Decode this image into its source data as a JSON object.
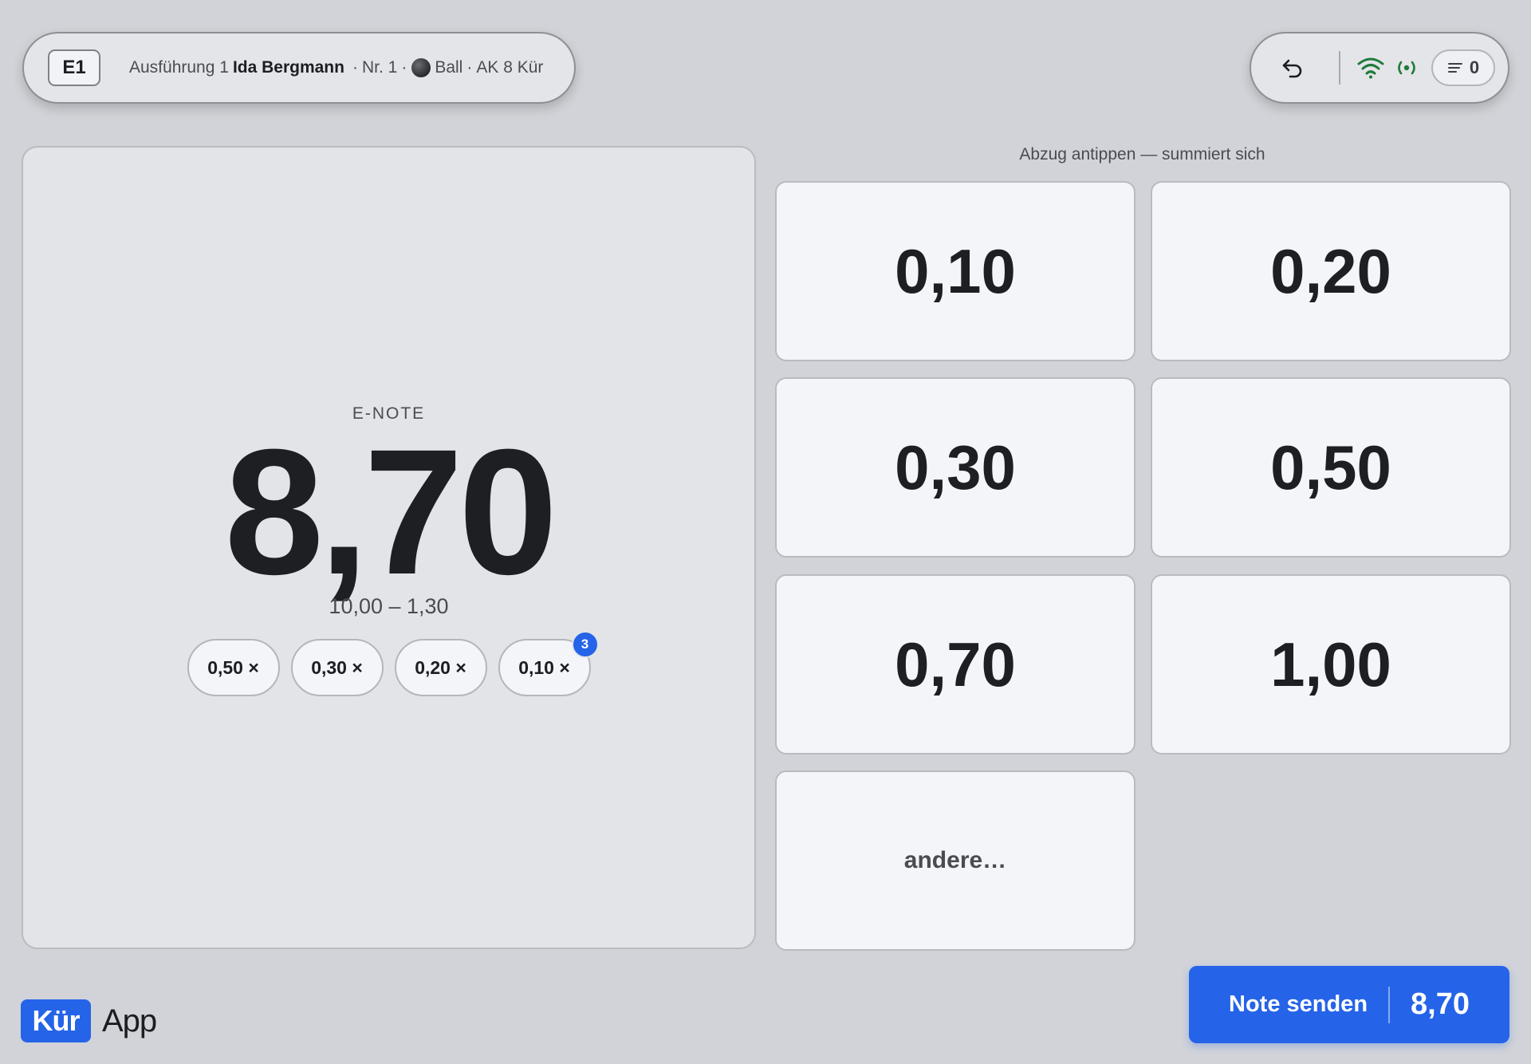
{
  "header": {
    "judge": "E1",
    "run_label": "Ausführung 1",
    "athlete": "Ida Bergmann",
    "start_no": "Nr. 1",
    "apparatus": "Ball",
    "category": "AK 8 Kür",
    "separator": "·",
    "queue_count": "0"
  },
  "score": {
    "label": "E-NOTE",
    "value": "8,70",
    "formula": "10,00 – 1,30",
    "chips": [
      {
        "label": "0,50 ×",
        "count": ""
      },
      {
        "label": "0,30 ×",
        "count": ""
      },
      {
        "label": "0,20 ×",
        "count": ""
      },
      {
        "label": "0,10 ×",
        "count": "3"
      }
    ]
  },
  "deductions": {
    "hint": "Abzug antippen — summiert sich",
    "tiles": [
      "0,10",
      "0,20",
      "0,30",
      "0,50",
      "0,70",
      "1,00"
    ],
    "other": "andere…"
  },
  "brand": {
    "mark": "Kür",
    "text": "App",
    "color": "#2563e8"
  },
  "submit": {
    "label": "Note senden",
    "value": "8,70"
  },
  "colors": {
    "accent": "#2563e8",
    "status_ok": "#1f7a3a",
    "background": "#d1d3d8"
  }
}
